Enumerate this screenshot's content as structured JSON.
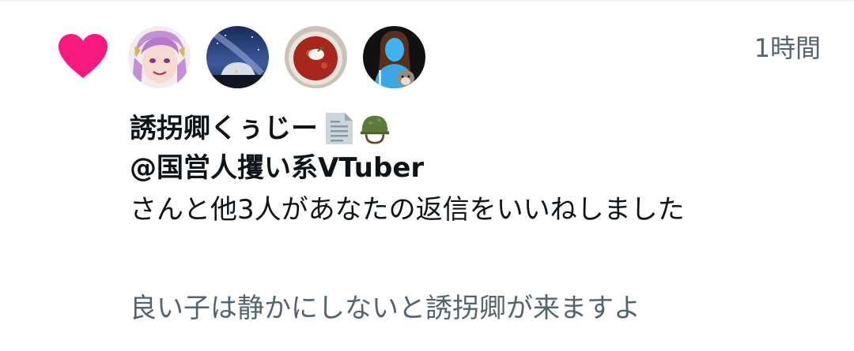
{
  "notification": {
    "type_icon": "heart-icon",
    "timestamp": "1時間",
    "avatars": [
      {
        "name": "avatar-anime-purple-hair"
      },
      {
        "name": "avatar-night-sky-dome"
      },
      {
        "name": "avatar-borscht-bowl"
      },
      {
        "name": "avatar-blue-character-with-dog"
      }
    ],
    "user": {
      "name": "誘拐卿くぅじー",
      "emoji": [
        "page-facing-up-icon",
        "military-helmet-icon"
      ],
      "handle": "@国営人攫い系VTuber"
    },
    "action_text": "さんと他3人があなたの返信をいいねしました",
    "quoted_text": "良い子は静かにしないと誘拐卿が来ますよ"
  },
  "colors": {
    "heart": "#f91880",
    "secondary_text": "#536471",
    "primary_text": "#0f1419"
  }
}
